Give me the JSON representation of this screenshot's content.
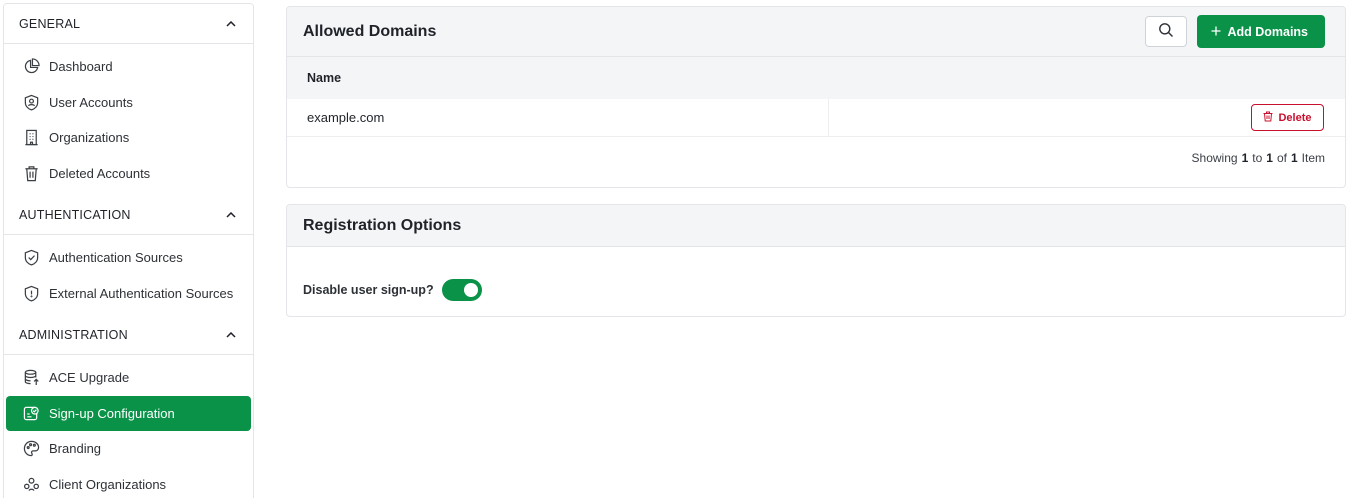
{
  "sidebar": {
    "sections": [
      {
        "title": "GENERAL",
        "items": [
          {
            "label": "Dashboard",
            "icon": "pie-chart-icon"
          },
          {
            "label": "User Accounts",
            "icon": "user-shield-icon"
          },
          {
            "label": "Organizations",
            "icon": "building-icon"
          },
          {
            "label": "Deleted Accounts",
            "icon": "trash-icon"
          }
        ]
      },
      {
        "title": "AUTHENTICATION",
        "items": [
          {
            "label": "Authentication Sources",
            "icon": "shield-check-icon"
          },
          {
            "label": "External Authentication Sources",
            "icon": "shield-icon"
          }
        ]
      },
      {
        "title": "ADMINISTRATION",
        "items": [
          {
            "label": "ACE Upgrade",
            "icon": "database-upgrade-icon"
          },
          {
            "label": "Sign-up Configuration",
            "icon": "signup-config-icon",
            "active": true
          },
          {
            "label": "Branding",
            "icon": "palette-icon"
          },
          {
            "label": "Client Organizations",
            "icon": "group-icon"
          }
        ]
      }
    ]
  },
  "allowed_domains": {
    "title": "Allowed Domains",
    "add_label": "Add Domains",
    "column_name": "Name",
    "rows": [
      {
        "name": "example.com",
        "action": "Delete"
      }
    ],
    "pager": {
      "showing": "Showing",
      "from": "1",
      "to_word": "to",
      "to": "1",
      "of_word": "of",
      "total": "1",
      "unit": "Item"
    }
  },
  "registration": {
    "title": "Registration Options",
    "disable_signup_label": "Disable user sign-up?",
    "disable_signup_on": true
  },
  "colors": {
    "accent": "#0a9348",
    "danger": "#c8102e"
  }
}
